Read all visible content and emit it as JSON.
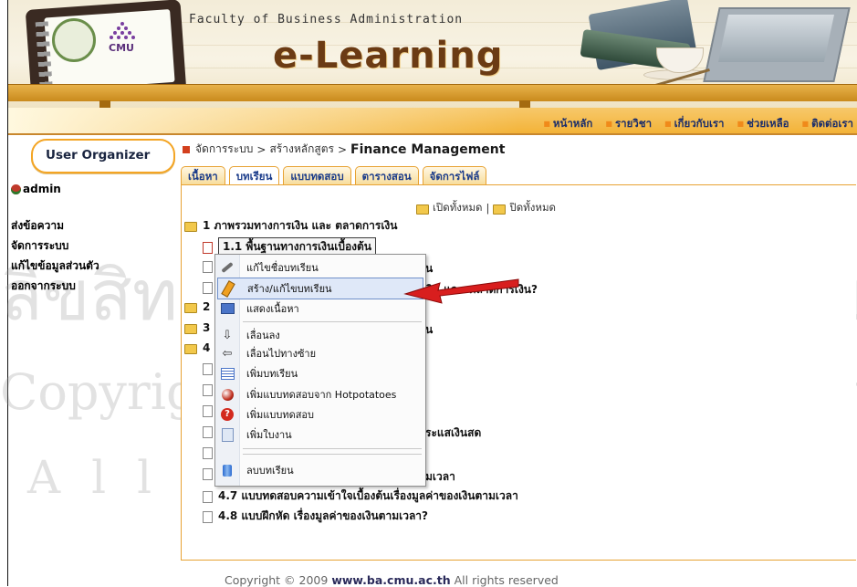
{
  "header": {
    "faculty_title": "Faculty of Business Administration",
    "app_title": "e-Learning",
    "logo_text": "CMU"
  },
  "top_nav": [
    "หน้าหลัก",
    "รายวิชา",
    "เกี่ยวกับเรา",
    "ช่วยเหลือ",
    "ติดต่อเรา"
  ],
  "sidebar": {
    "panel_title": "User Organizer",
    "username": "admin",
    "links": [
      "ส่งข้อความ",
      "จัดการระบบ",
      "แก้ไขข้อมูลส่วนตัว",
      "ออกจากระบบ"
    ]
  },
  "breadcrumb": {
    "part1": "จัดการระบบ",
    "sep": ">",
    "part2": "สร้างหลักสูตร",
    "current": "Finance Management"
  },
  "tabs": [
    {
      "label": "เนื้อหา",
      "active": false
    },
    {
      "label": "บทเรียน",
      "active": true
    },
    {
      "label": "แบบทดสอบ",
      "active": false
    },
    {
      "label": "ตารางสอน",
      "active": false
    },
    {
      "label": "จัดการไฟล์",
      "active": false
    }
  ],
  "tree": {
    "expand_all": "เปิดทั้งหมด",
    "divider": "|",
    "collapse_all": "ปิดทั้งหมด",
    "items": {
      "n1": "1  ภาพรวมทางการเงิน และ ตลาดการเงิน",
      "n1_1": "1.1  พื้นฐานทางการเงินเบื้องต้น",
      "n1_2_tail": "ิน",
      "n1_3_tail": "ตลาดการเงิน?",
      "n2": "2",
      "n3": "3",
      "n3_tail": "น",
      "n4": "4",
      "n4_x_tail": "ระแสเงินสด",
      "n4_6_tail": "มเวลา",
      "n4_7": "4.7  แบบทดสอบความเข้าใจเบื้องต้นเรื่องมูลค่าของเงินตามเวลา",
      "n4_8": "4.8  แบบฝึกหัด  เรื่องมูลค่าของเงินตามเวลา?"
    }
  },
  "context_menu": {
    "items": [
      {
        "label": "แก้ไขชื่อบทเรียน",
        "icon": "wrench-icon",
        "highlighted": false
      },
      {
        "label": "สร้าง/แก้ไขบทเรียน",
        "icon": "pencil-icon",
        "highlighted": true
      },
      {
        "label": "แสดงเนื้อหา",
        "icon": "monitor-icon",
        "highlighted": false
      },
      {
        "label": "เลื่อนลง",
        "icon": "arrow-down-icon",
        "highlighted": false
      },
      {
        "label": "เลื่อนไปทางซ้าย",
        "icon": "arrow-left-icon",
        "highlighted": false
      },
      {
        "label": "เพิ่มบทเรียน",
        "icon": "list-icon",
        "highlighted": false
      },
      {
        "label": "เพิ่มแบบทดสอบจาก Hotpotatoes",
        "icon": "hotpotatoes-icon",
        "highlighted": false
      },
      {
        "label": "เพิ่มแบบทดสอบ",
        "icon": "question-icon",
        "highlighted": false
      },
      {
        "label": "เพิ่มใบงาน",
        "icon": "worksheet-icon",
        "highlighted": false
      },
      {
        "label": "ลบบทเรียน",
        "icon": "delete-icon",
        "highlighted": false
      }
    ]
  },
  "watermark": {
    "line1": "ลิขสิทธิ์มหาวิทยาลัยเชียงใหม่",
    "line2": "Copyright© by Chiang Mai University",
    "line3": "All rights reserved"
  },
  "footer": {
    "prefix": "Copyright © 2009",
    "site": "www.ba.cmu.ac.th",
    "suffix": "All rights reserved"
  },
  "colors": {
    "accent_orange": "#f3b338",
    "nav_text": "#1a2d6b",
    "highlight_blue": "#dfe8f8",
    "arrow_red": "#d81e1e"
  }
}
